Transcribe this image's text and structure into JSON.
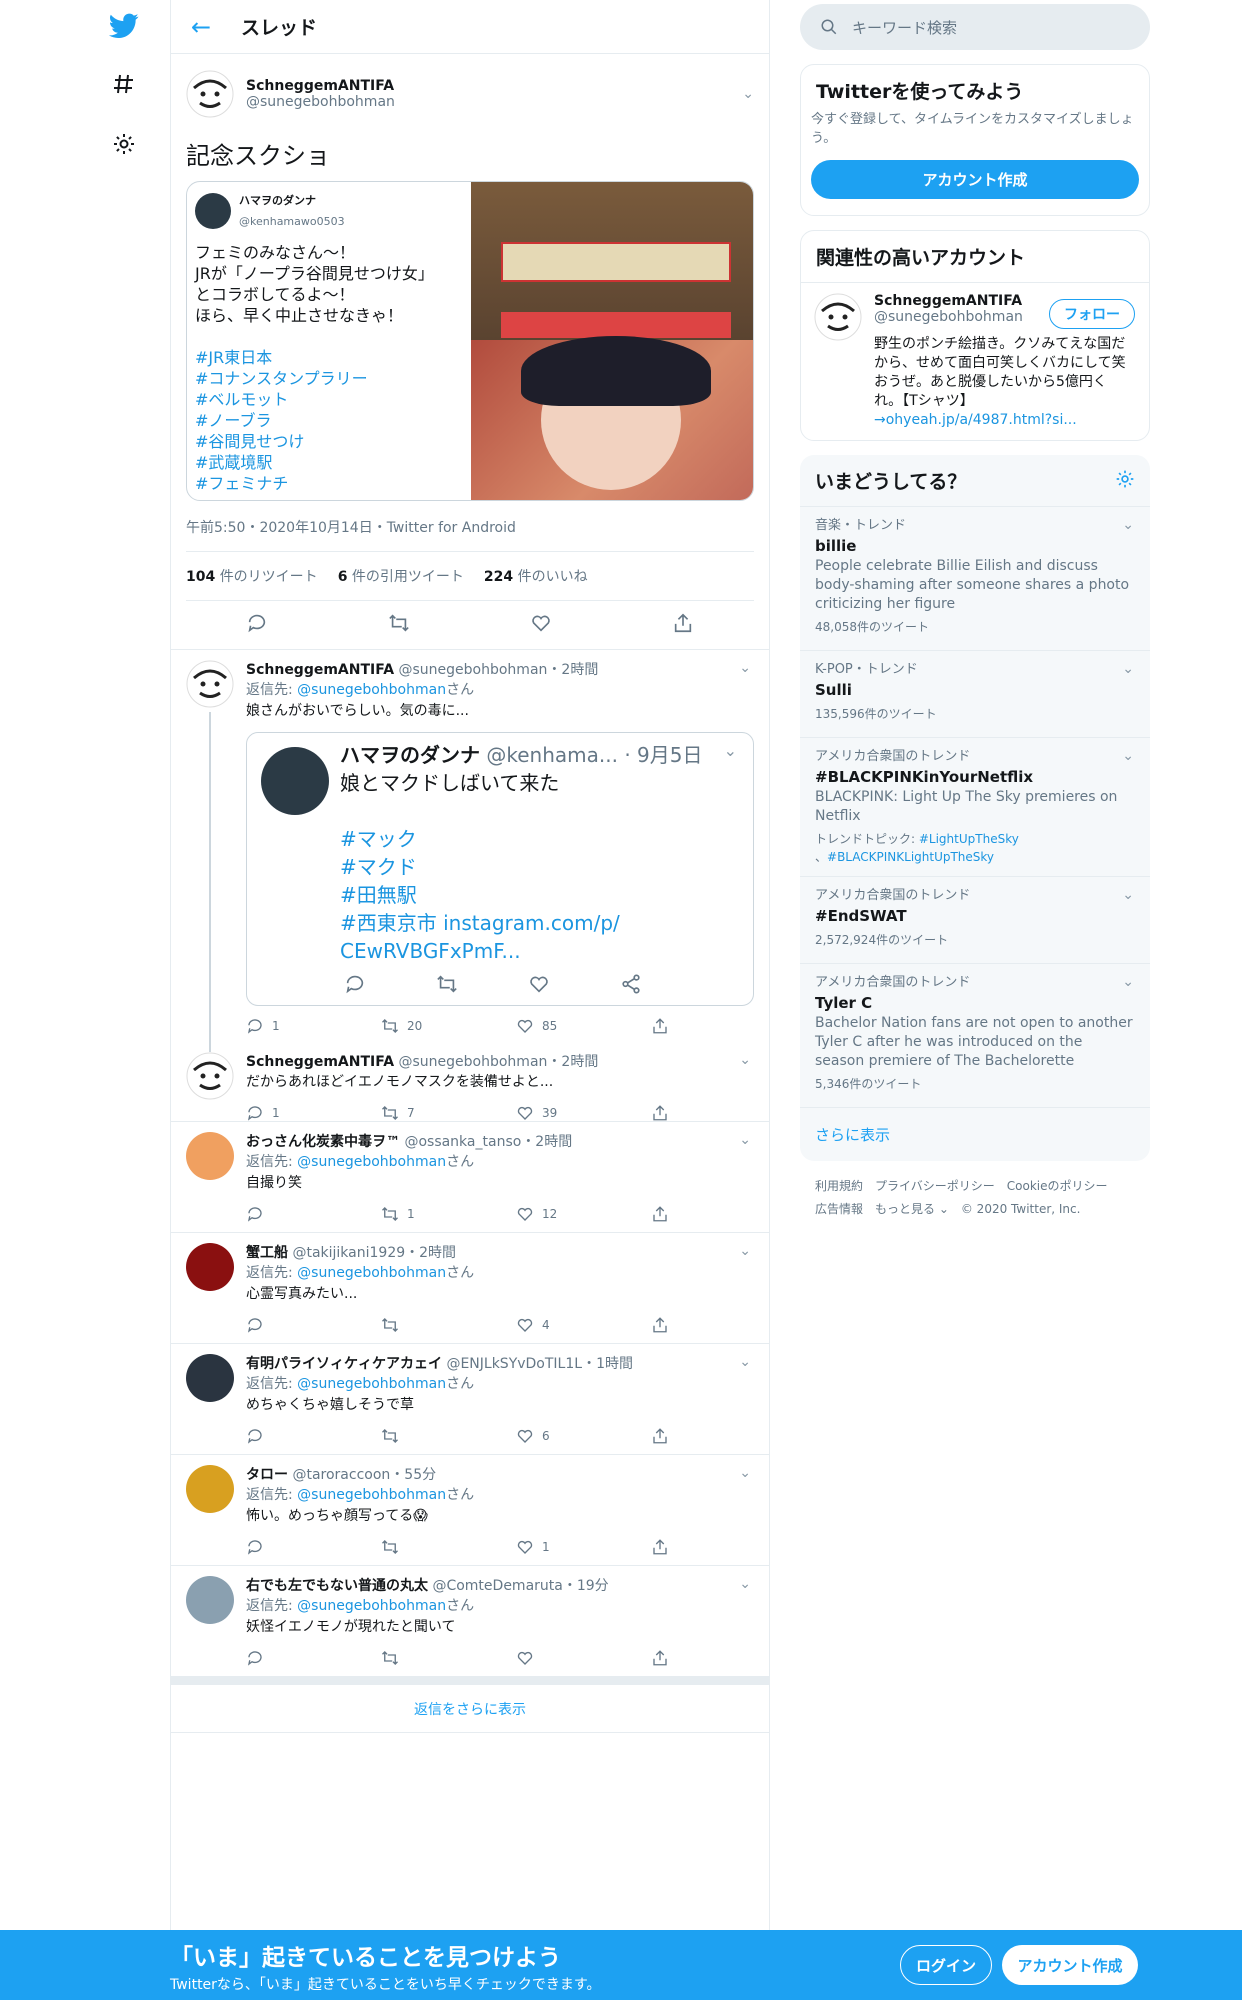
{
  "header": {
    "back": "←",
    "title": "スレッド"
  },
  "focal": {
    "name": "SchneggemANTIFA",
    "handle": "@sunegebohbohman",
    "text": "記念スクショ",
    "embed": {
      "name": "ハマヲのダンナ",
      "handle": "@kenhamawo0503",
      "lines": [
        "フェミのみなさん〜！",
        "JRが「ノープラ谷間見せつけ女」",
        "とコラボしてるよ〜！",
        "ほら、早く中止させなきゃ！"
      ],
      "tags": [
        "#JR東日本",
        "#コナンスタンプラリー",
        "#ベルモット",
        "#ノーブラ",
        "#谷間見せつけ",
        "#武蔵境駅",
        "#フェミナチ"
      ]
    },
    "meta": "午前5:50・2020年10月14日・Twitter for Android",
    "stats": {
      "retweets": "104",
      "retweets_label": "件のリツイート",
      "quotes": "6",
      "quotes_label": "件の引用ツイート",
      "likes": "224",
      "likes_label": "件のいいね"
    }
  },
  "replies": [
    {
      "name": "SchneggemANTIFA",
      "handle": "@sunegebohbohman",
      "time": "・2時間",
      "reply_prefix": "返信先: ",
      "reply_to": "@sunegebohbohman",
      "reply_suffix": "さん",
      "text": "娘さんがおいでらしい。気の毒に...",
      "quote": {
        "name": "ハマヲのダンナ",
        "handle": "@kenhama...",
        "time": "· 9月5日",
        "text": "娘とマクドしばいて来た",
        "tags": [
          "#マック",
          "#マクド",
          "#田無駅",
          "#西東京市 instagram.com/p/",
          "CEwRVBGFxPmF..."
        ]
      },
      "counts": {
        "reply": "1",
        "retweet": "20",
        "like": "85"
      }
    },
    {
      "name": "SchneggemANTIFA",
      "handle": "@sunegebohbohman",
      "time": "・2時間",
      "text": "だからあれほどイエノモノマスクを装備せよと...",
      "counts": {
        "reply": "1",
        "retweet": "7",
        "like": "39"
      }
    },
    {
      "name": "おっさん化炭素中毒ヲ™",
      "handle": "@ossanka_tanso",
      "time": "・2時間",
      "reply_prefix": "返信先: ",
      "reply_to": "@sunegebohbohman",
      "reply_suffix": "さん",
      "text": "自撮り笑",
      "counts": {
        "reply": "",
        "retweet": "1",
        "like": "12"
      }
    },
    {
      "name": "蟹工船",
      "handle": "@takijikani1929",
      "time": "・2時間",
      "reply_prefix": "返信先: ",
      "reply_to": "@sunegebohbohman",
      "reply_suffix": "さん",
      "text": "心霊写真みたい...",
      "counts": {
        "reply": "",
        "retweet": "",
        "like": "4"
      }
    },
    {
      "name": "有明パライソィケィケアカェイ",
      "handle": "@ENJLkSYvDoTIL1L",
      "time": "・1時間",
      "reply_prefix": "返信先: ",
      "reply_to": "@sunegebohbohman",
      "reply_suffix": "さん",
      "text": "めちゃくちゃ嬉しそうで草",
      "counts": {
        "reply": "",
        "retweet": "",
        "like": "6"
      }
    },
    {
      "name": "タロー",
      "handle": "@taroraccoon",
      "time": "・55分",
      "reply_prefix": "返信先: ",
      "reply_to": "@sunegebohbohman",
      "reply_suffix": "さん",
      "text": "怖い。めっちゃ顔写ってる😱",
      "counts": {
        "reply": "",
        "retweet": "",
        "like": "1"
      }
    },
    {
      "name": "右でも左でもない普通の丸太",
      "handle": "@ComteDemaruta",
      "time": "・19分",
      "reply_prefix": "返信先: ",
      "reply_to": "@sunegebohbohman",
      "reply_suffix": "さん",
      "text": "妖怪イエノモノが現れたと聞いて",
      "counts": {
        "reply": "",
        "retweet": "",
        "like": ""
      }
    }
  ],
  "show_more": "返信をさらに表示",
  "sidebar": {
    "search_placeholder": "キーワード検索",
    "signup": {
      "title": "Twitterを使ってみよう",
      "text": "今すぐ登録して、タイムラインをカスタマイズしましょう。",
      "button": "アカウント作成"
    },
    "related": {
      "title": "関連性の高いアカウント",
      "name": "SchneggemANTIFA",
      "handle": "@sunegebohbohman",
      "follow": "フォロー",
      "bio": "野生のポンチ絵描き。クソみてえな国だから、せめて面白可笑しくバカにして笑おうぜ。あと脱優したいから5億円くれ。【Tシャツ】",
      "link": "→ohyeah.jp/a/4987.html?si..."
    },
    "trends": {
      "title": "いまどうしてる？",
      "items": [
        {
          "cat": "音楽・トレンド",
          "name": "billie",
          "desc": "People celebrate Billie Eilish and discuss body-shaming after someone shares a photo criticizing her figure",
          "count": "48,058件のツイート"
        },
        {
          "cat": "K-POP・トレンド",
          "name": "Sulli",
          "desc": "",
          "count": "135,596件のツイート"
        },
        {
          "cat": "アメリカ合衆国のトレンド",
          "name": "#BLACKPINKinYourNetflix",
          "desc": "BLACKPINK: Light Up The Sky premieres on Netflix",
          "topic_label": "トレンドトピック: ",
          "topic1": "#LightUpTheSky",
          "topic2": "#BLACKPINKLightUpTheSky",
          "count": ""
        },
        {
          "cat": "アメリカ合衆国のトレンド",
          "name": "#EndSWAT",
          "desc": "",
          "count": "2,572,924件のツイート"
        },
        {
          "cat": "アメリカ合衆国のトレンド",
          "name": "Tyler C",
          "desc": "Bachelor Nation fans are not open to another Tyler C after he was introduced on the season premiere of The Bachelorette",
          "count": "5,346件のツイート"
        }
      ],
      "more": "さらに表示"
    },
    "footer": {
      "line1": "利用規約　プライバシーポリシー　Cookieのポリシー",
      "line2": "広告情報　もっと見る ⌄　© 2020 Twitter, Inc."
    }
  },
  "banner": {
    "title": "「いま」起きていることを見つけよう",
    "sub": "Twitterなら、「いま」起きていることをいち早くチェックできます。",
    "login": "ログイン",
    "signup": "アカウント作成"
  },
  "colors": {
    "accent": "#1da1f2",
    "link": "#1b95e0",
    "border": "#e6ecf0",
    "muted": "#657786"
  }
}
